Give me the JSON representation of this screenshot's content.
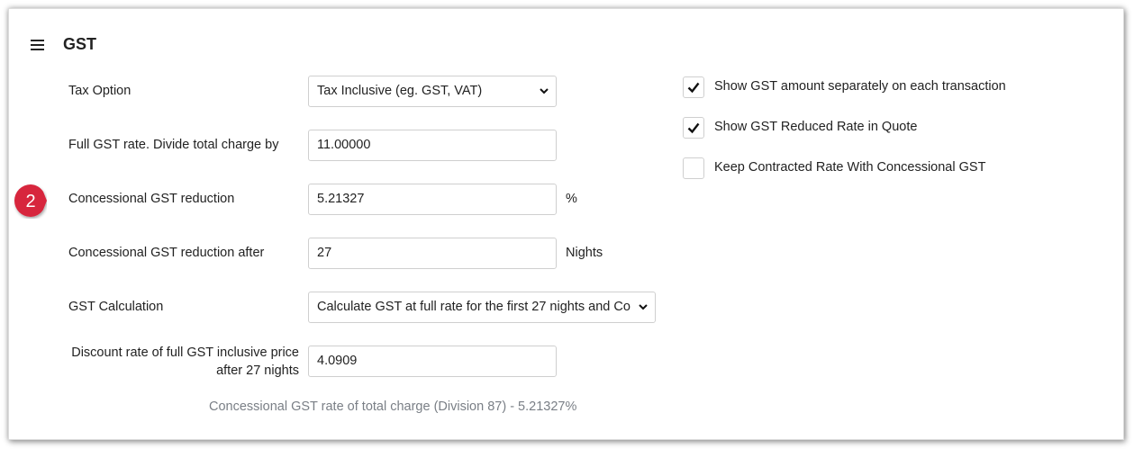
{
  "header": {
    "title": "GST",
    "menu_icon": "hamburger-menu-icon"
  },
  "form": {
    "tax_option": {
      "label": "Tax Option",
      "value": "Tax Inclusive (eg. GST, VAT)"
    },
    "full_rate": {
      "label": "Full GST rate. Divide total charge by",
      "value": "11.00000"
    },
    "concessional_reduction": {
      "label": "Concessional GST reduction",
      "value": "5.21327",
      "unit": "%"
    },
    "reduction_after": {
      "label": "Concessional GST reduction after",
      "value": "27",
      "unit": "Nights"
    },
    "gst_calculation": {
      "label": "GST Calculation",
      "value": "Calculate GST at full rate for the first 27 nights and Co"
    },
    "discount_rate": {
      "label_line1": "Discount rate of full GST inclusive price",
      "label_line2": "after 27 nights",
      "value": "4.0909"
    },
    "note": "Concessional GST rate of total charge (Division 87) - 5.21327%"
  },
  "options": [
    {
      "label": "Show GST amount separately on each transaction",
      "checked": true
    },
    {
      "label": "Show GST Reduced Rate in Quote",
      "checked": true
    },
    {
      "label": "Keep Contracted Rate With Concessional GST",
      "checked": false
    }
  ],
  "callout": {
    "number": "2",
    "color": "#d7263d"
  },
  "colors": {
    "note_text": "#7a7f86",
    "border": "#cfcfcf"
  }
}
